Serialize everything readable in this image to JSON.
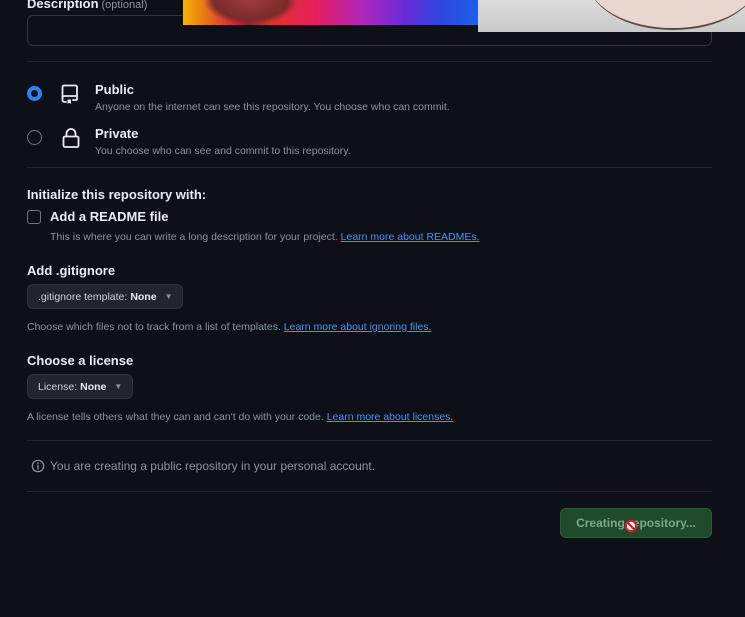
{
  "description": {
    "label": "Description",
    "optional": "(optional)",
    "value": ""
  },
  "visibility": {
    "options": [
      {
        "title": "Public",
        "subtitle": "Anyone on the internet can see this repository. You choose who can commit.",
        "selected": true,
        "icon": "repo-icon"
      },
      {
        "title": "Private",
        "subtitle": "You choose who can see and commit to this repository.",
        "selected": false,
        "icon": "lock-icon"
      }
    ]
  },
  "initialize": {
    "title": "Initialize this repository with:",
    "readme": {
      "label": "Add a README file",
      "checked": false,
      "help": "This is where you can write a long description for your project.",
      "link": "Learn more about READMEs."
    }
  },
  "gitignore": {
    "title": "Add .gitignore",
    "select_prefix": ".gitignore template:",
    "select_value": "None",
    "help": "Choose which files not to track from a list of templates.",
    "link": "Learn more about ignoring files."
  },
  "license": {
    "title": "Choose a license",
    "select_prefix": "License:",
    "select_value": "None",
    "help": "A license tells others what they can and can't do with your code.",
    "link": "Learn more about licenses."
  },
  "notice": {
    "icon": "info-icon",
    "text": "You are creating a public repository in your personal account."
  },
  "submit": {
    "label": "Creating repository..."
  },
  "colors": {
    "background": "#0d1117",
    "accent": "#2f81f7",
    "link": "#4493f8",
    "button_disabled": "#1f4a2c"
  }
}
